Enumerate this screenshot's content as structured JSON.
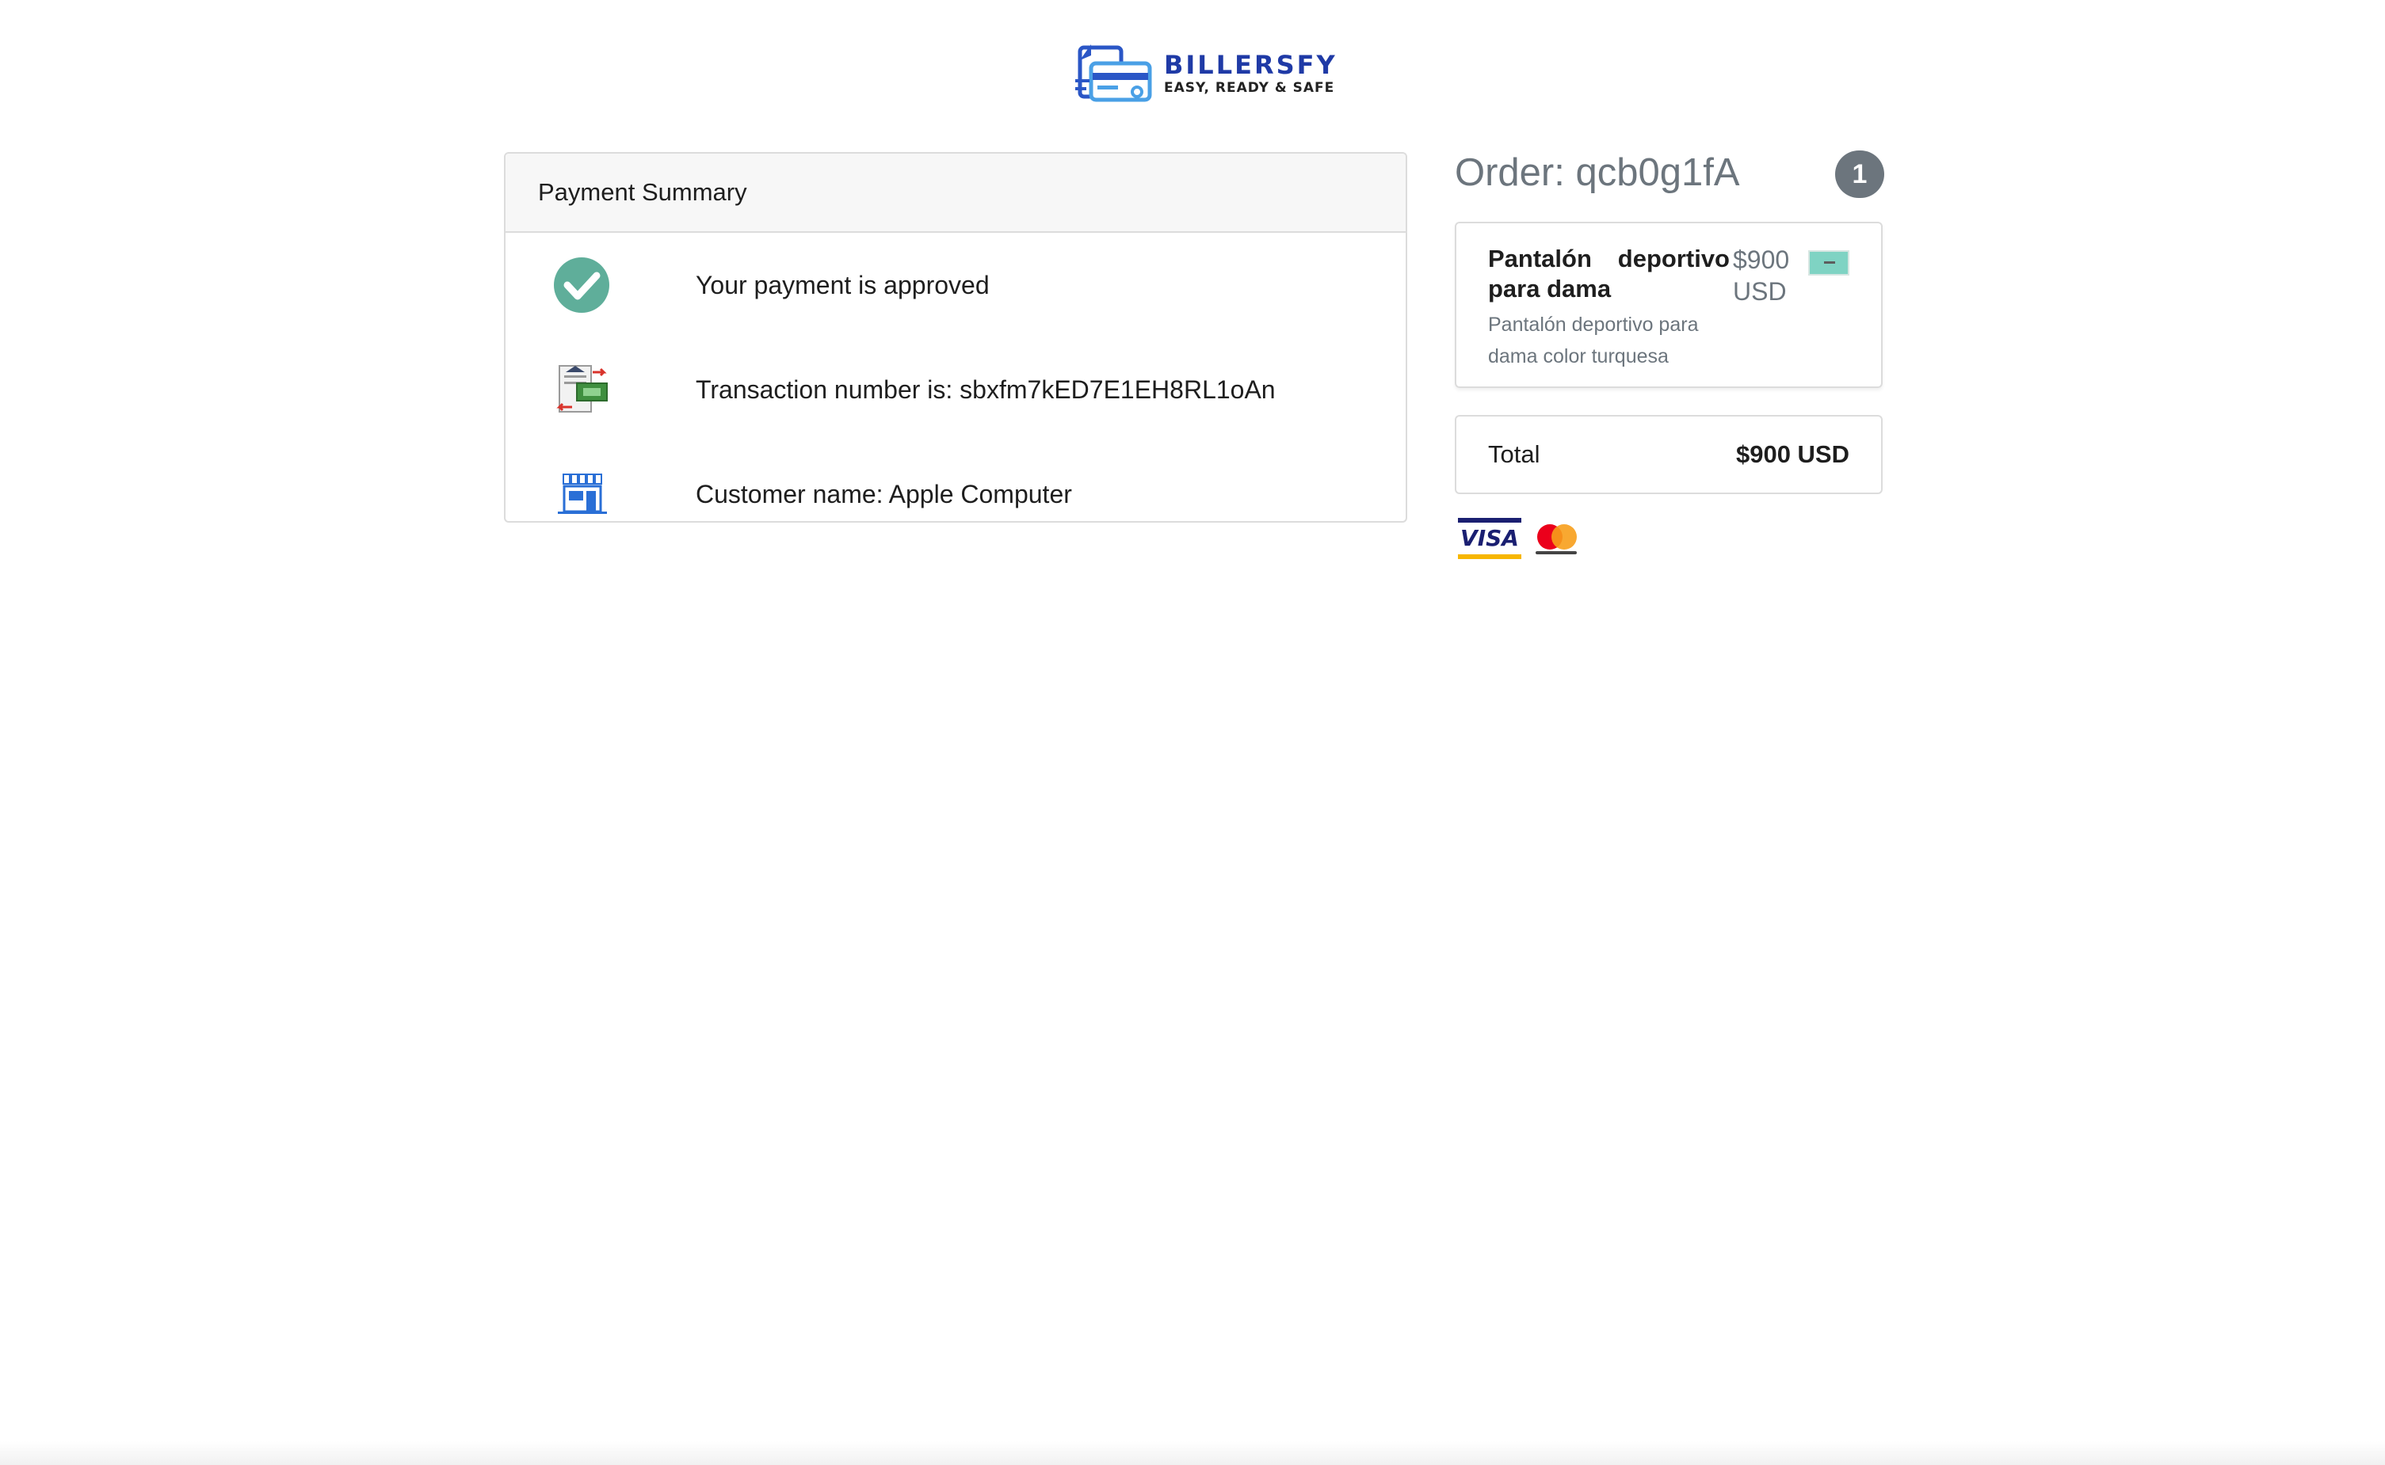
{
  "brand": {
    "name": "BILLERSFY",
    "tagline": "EASY, READY & SAFE"
  },
  "summary": {
    "title": "Payment Summary",
    "rows": [
      {
        "icon": "check-circle-icon",
        "text": "Your payment is approved"
      },
      {
        "icon": "transaction-document-icon",
        "text": "Transaction number is: sbxfm7kED7E1EH8RL1oAn"
      },
      {
        "icon": "store-icon",
        "text": "Customer name: Apple Computer"
      }
    ]
  },
  "order": {
    "title": "Order: qcb0g1fA",
    "item_count": "1",
    "item": {
      "name": "Pantalón deportivo para dama",
      "price": "$900 USD",
      "description": "Pantalón deportivo para dama color turquesa"
    },
    "total_label": "Total",
    "total_value": "$900 USD"
  },
  "payment_methods": [
    "visa-icon",
    "mastercard-icon"
  ],
  "colors": {
    "brand": "#1f3aa6",
    "success": "#5fae9a",
    "muted": "#6c757d",
    "border": "#dcdcdc"
  }
}
